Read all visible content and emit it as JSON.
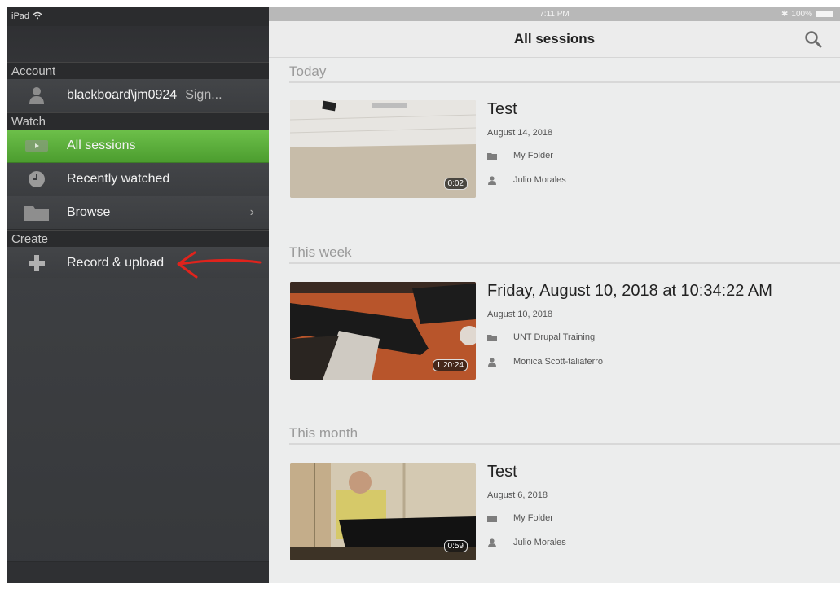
{
  "status_left": "iPad",
  "status_time": "7:11 PM",
  "status_battery": "100%",
  "sidebar": {
    "sections": [
      {
        "label": "Account"
      },
      {
        "label": "Watch"
      },
      {
        "label": "Create"
      }
    ],
    "account": {
      "user": "blackboard\\jm0924",
      "action": "Sign..."
    },
    "items": [
      {
        "label": "All sessions"
      },
      {
        "label": "Recently watched"
      },
      {
        "label": "Browse"
      },
      {
        "label": "Record & upload"
      }
    ]
  },
  "main": {
    "title": "All sessions",
    "groups": [
      {
        "label": "Today"
      },
      {
        "label": "This week"
      },
      {
        "label": "This month"
      }
    ],
    "sessions": [
      {
        "title": "Test",
        "date": "August 14, 2018",
        "folder": "My Folder",
        "owner": "Julio Morales",
        "duration": "0:02"
      },
      {
        "title": "Friday, August 10, 2018 at 10:34:22 AM",
        "date": "August 10, 2018",
        "folder": "UNT Drupal Training",
        "owner": "Monica Scott-taliaferro",
        "duration": "1:20:24"
      },
      {
        "title": "Test",
        "date": "August 6, 2018",
        "folder": "My Folder",
        "owner": "Julio Morales",
        "duration": "0:59"
      }
    ]
  },
  "colors": {
    "accent_green": "#5aae3a",
    "annotation_red": "#e0231c"
  }
}
